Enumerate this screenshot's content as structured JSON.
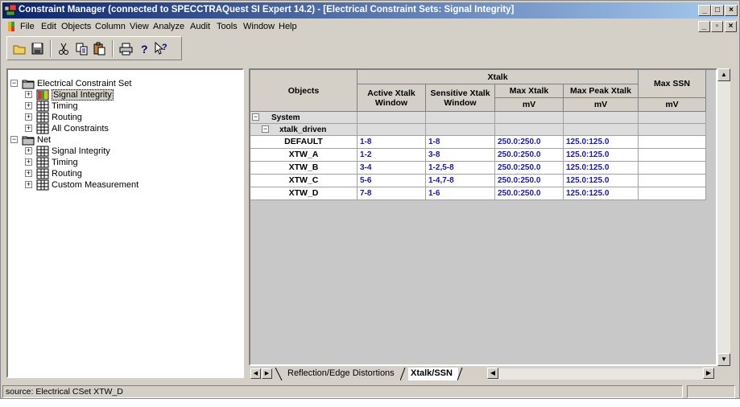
{
  "window": {
    "title": "Constraint Manager (connected to SPECCTRAQuest SI Expert 14.2) - [Electrical Constraint Sets: Signal Integrity]"
  },
  "menu": {
    "items": [
      "File",
      "Edit",
      "Objects",
      "Column",
      "View",
      "Analyze",
      "Audit",
      "Tools",
      "Window",
      "Help"
    ]
  },
  "toolbar": {
    "buttons": [
      "open-icon",
      "save-icon",
      "cut-icon",
      "copy-icon",
      "paste-icon",
      "print-icon",
      "help-icon",
      "context-help-icon"
    ]
  },
  "tree": {
    "items": [
      {
        "label": "Electrical Constraint Set",
        "expander": "−",
        "level": 0
      },
      {
        "label": "Signal Integrity",
        "expander": "+",
        "level": 1,
        "selected": true
      },
      {
        "label": "Timing",
        "expander": "+",
        "level": 1
      },
      {
        "label": "Routing",
        "expander": "+",
        "level": 1
      },
      {
        "label": "All Constraints",
        "expander": "+",
        "level": 1
      },
      {
        "label": "Net",
        "expander": "−",
        "level": 0
      },
      {
        "label": "Signal Integrity",
        "expander": "+",
        "level": 1
      },
      {
        "label": "Timing",
        "expander": "+",
        "level": 1
      },
      {
        "label": "Routing",
        "expander": "+",
        "level": 1
      },
      {
        "label": "Custom Measurement",
        "expander": "+",
        "level": 1
      }
    ]
  },
  "grid": {
    "objects_header": "Objects",
    "group_header": "Xtalk",
    "columns": [
      {
        "line1": "Active Xtalk",
        "line2": "Window",
        "unit": ""
      },
      {
        "line1": "Sensitive Xtalk",
        "line2": "Window",
        "unit": ""
      },
      {
        "line1": "Max Xtalk",
        "line2": "",
        "unit": "mV"
      },
      {
        "line1": "Max Peak Xtalk",
        "line2": "",
        "unit": "mV"
      },
      {
        "line1": "Max SSN",
        "line2": "",
        "unit": "mV"
      }
    ],
    "system_row": "System",
    "group_row": "xtalk_driven",
    "rows": [
      {
        "name": "DEFAULT",
        "active": "1-8",
        "sensitive": "1-8",
        "max_xtalk": "250.0:250.0",
        "max_peak": "125.0:125.0",
        "max_ssn": ""
      },
      {
        "name": "XTW_A",
        "active": "1-2",
        "sensitive": "3-8",
        "max_xtalk": "250.0:250.0",
        "max_peak": "125.0:125.0",
        "max_ssn": ""
      },
      {
        "name": "XTW_B",
        "active": "3-4",
        "sensitive": "1-2,5-8",
        "max_xtalk": "250.0:250.0",
        "max_peak": "125.0:125.0",
        "max_ssn": ""
      },
      {
        "name": "XTW_C",
        "active": "5-6",
        "sensitive": "1-4,7-8",
        "max_xtalk": "250.0:250.0",
        "max_peak": "125.0:125.0",
        "max_ssn": ""
      },
      {
        "name": "XTW_D",
        "active": "7-8",
        "sensitive": "1-6",
        "max_xtalk": "250.0:250.0",
        "max_peak": "125.0:125.0",
        "max_ssn": ""
      }
    ]
  },
  "tabs": {
    "items": [
      "Reflection/Edge Distortions",
      "Xtalk/SSN"
    ],
    "active": "Xtalk/SSN"
  },
  "status": {
    "text": "source: Electrical CSet XTW_D"
  }
}
